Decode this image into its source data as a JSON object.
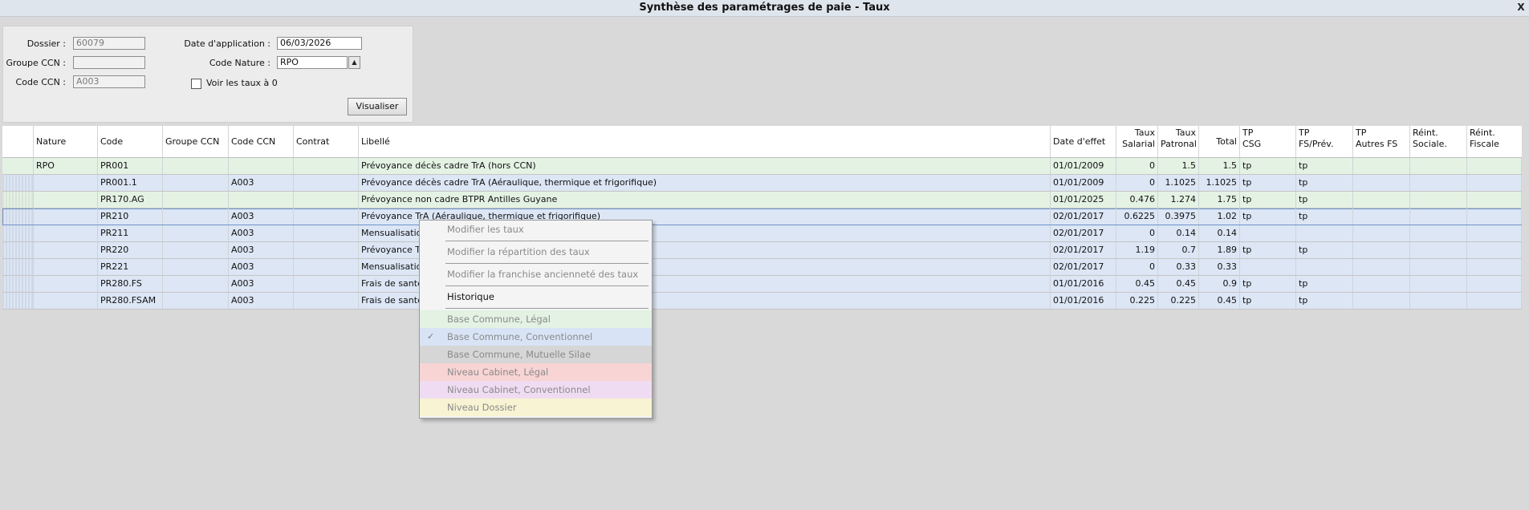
{
  "window": {
    "title": "Synthèse des paramétrages de paie - Taux",
    "close_glyph": "X"
  },
  "filters": {
    "dossier_label": "Dossier :",
    "dossier_value": "60079",
    "groupe_label": "Groupe CCN :",
    "groupe_value": "",
    "code_ccn_label": "Code CCN :",
    "code_ccn_value": "A003",
    "date_label": "Date d'application :",
    "date_value": "06/03/2026",
    "nature_label": "Code Nature :",
    "nature_value": "RPO",
    "combo_glyph": "▲",
    "voir_label": "Voir les taux à 0",
    "visualiser_label": "Visualiser"
  },
  "grid": {
    "headers": {
      "nature": "Nature",
      "code": "Code",
      "groupe": "Groupe CCN",
      "codeccn": "Code CCN",
      "contrat": "Contrat",
      "libelle": "Libellé",
      "date": "Date d'effet",
      "ts1": "Taux",
      "ts2": "Salarial",
      "tp1": "Taux",
      "tp2": "Patronal",
      "total": "Total",
      "tpcsg1": "TP",
      "tpcsg2": "CSG",
      "tpfs1": "TP",
      "tpfs2": "FS/Prév.",
      "tpaut1": "TP",
      "tpaut2": "Autres FS",
      "reis1": "Réint.",
      "reis2": "Sociale.",
      "reif1": "Réint.",
      "reif2": "Fiscale"
    },
    "rows": [
      {
        "nature": "RPO",
        "code": "PR001",
        "groupe": "",
        "codeccn": "",
        "contrat": "",
        "libelle": "Prévoyance décès cadre TrA (hors CCN)",
        "date": "01/01/2009",
        "ts": "0",
        "tp": "1.5",
        "total": "1.5",
        "tpcsg": "tp",
        "tpfs": "tp",
        "tpaut": "",
        "reis": "",
        "reif": ""
      },
      {
        "nature": "",
        "code": "PR001.1",
        "groupe": "",
        "codeccn": "A003",
        "contrat": "",
        "libelle": "Prévoyance décès cadre TrA (Aéraulique, thermique et frigorifique)",
        "date": "01/01/2009",
        "ts": "0",
        "tp": "1.1025",
        "total": "1.1025",
        "tpcsg": "tp",
        "tpfs": "tp",
        "tpaut": "",
        "reis": "",
        "reif": ""
      },
      {
        "nature": "",
        "code": "PR170.AG",
        "groupe": "",
        "codeccn": "",
        "contrat": "",
        "libelle": "Prévoyance non cadre BTPR Antilles Guyane",
        "date": "01/01/2025",
        "ts": "0.476",
        "tp": "1.274",
        "total": "1.75",
        "tpcsg": "tp",
        "tpfs": "tp",
        "tpaut": "",
        "reis": "",
        "reif": ""
      },
      {
        "nature": "",
        "code": "PR210",
        "groupe": "",
        "codeccn": "A003",
        "contrat": "",
        "libelle": "Prévoyance TrA (Aéraulique, thermique et frigorifique)",
        "date": "02/01/2017",
        "ts": "0.6225",
        "tp": "0.3975",
        "total": "1.02",
        "tpcsg": "tp",
        "tpfs": "tp",
        "tpaut": "",
        "reis": "",
        "reif": ""
      },
      {
        "nature": "",
        "code": "PR211",
        "groupe": "",
        "codeccn": "A003",
        "contrat": "",
        "libelle": "Mensualisation",
        "date": "02/01/2017",
        "ts": "0",
        "tp": "0.14",
        "total": "0.14",
        "tpcsg": "",
        "tpfs": "",
        "tpaut": "",
        "reis": "",
        "reif": ""
      },
      {
        "nature": "",
        "code": "PR220",
        "groupe": "",
        "codeccn": "A003",
        "contrat": "",
        "libelle": "Prévoyance Tr",
        "date": "02/01/2017",
        "ts": "1.19",
        "tp": "0.7",
        "total": "1.89",
        "tpcsg": "tp",
        "tpfs": "tp",
        "tpaut": "",
        "reis": "",
        "reif": ""
      },
      {
        "nature": "",
        "code": "PR221",
        "groupe": "",
        "codeccn": "A003",
        "contrat": "",
        "libelle": "Mensualisation",
        "date": "02/01/2017",
        "ts": "0",
        "tp": "0.33",
        "total": "0.33",
        "tpcsg": "",
        "tpfs": "",
        "tpaut": "",
        "reis": "",
        "reif": ""
      },
      {
        "nature": "",
        "code": "PR280.FS",
        "groupe": "",
        "codeccn": "A003",
        "contrat": "",
        "libelle": "Frais de santé",
        "date": "01/01/2016",
        "ts": "0.45",
        "tp": "0.45",
        "total": "0.9",
        "tpcsg": "tp",
        "tpfs": "tp",
        "tpaut": "",
        "reis": "",
        "reif": ""
      },
      {
        "nature": "",
        "code": "PR280.FSAM",
        "groupe": "",
        "codeccn": "A003",
        "contrat": "",
        "libelle": "Frais de santé",
        "date": "01/01/2016",
        "ts": "0.225",
        "tp": "0.225",
        "total": "0.45",
        "tpcsg": "tp",
        "tpfs": "tp",
        "tpaut": "",
        "reis": "",
        "reif": ""
      }
    ]
  },
  "context_menu": {
    "items": [
      {
        "label": "Modifier les taux"
      },
      {
        "label": "Modifier la répartition des taux"
      },
      {
        "label": "Modifier la franchise ancienneté des taux"
      },
      {
        "label": "Historique"
      },
      {
        "label": "Base Commune, Légal",
        "color": "#e3f2e3"
      },
      {
        "label": "Base Commune, Conventionnel",
        "color": "#d8e4f6",
        "check": "✓"
      },
      {
        "label": "Base Commune, Mutuelle Silae",
        "color": "#d6d6d6"
      },
      {
        "label": "Niveau Cabinet, Légal",
        "color": "#f8d4d4"
      },
      {
        "label": "Niveau Cabinet, Conventionnel",
        "color": "#f0dcf2"
      },
      {
        "label": "Niveau Dossier",
        "color": "#f8f3d2"
      }
    ]
  }
}
